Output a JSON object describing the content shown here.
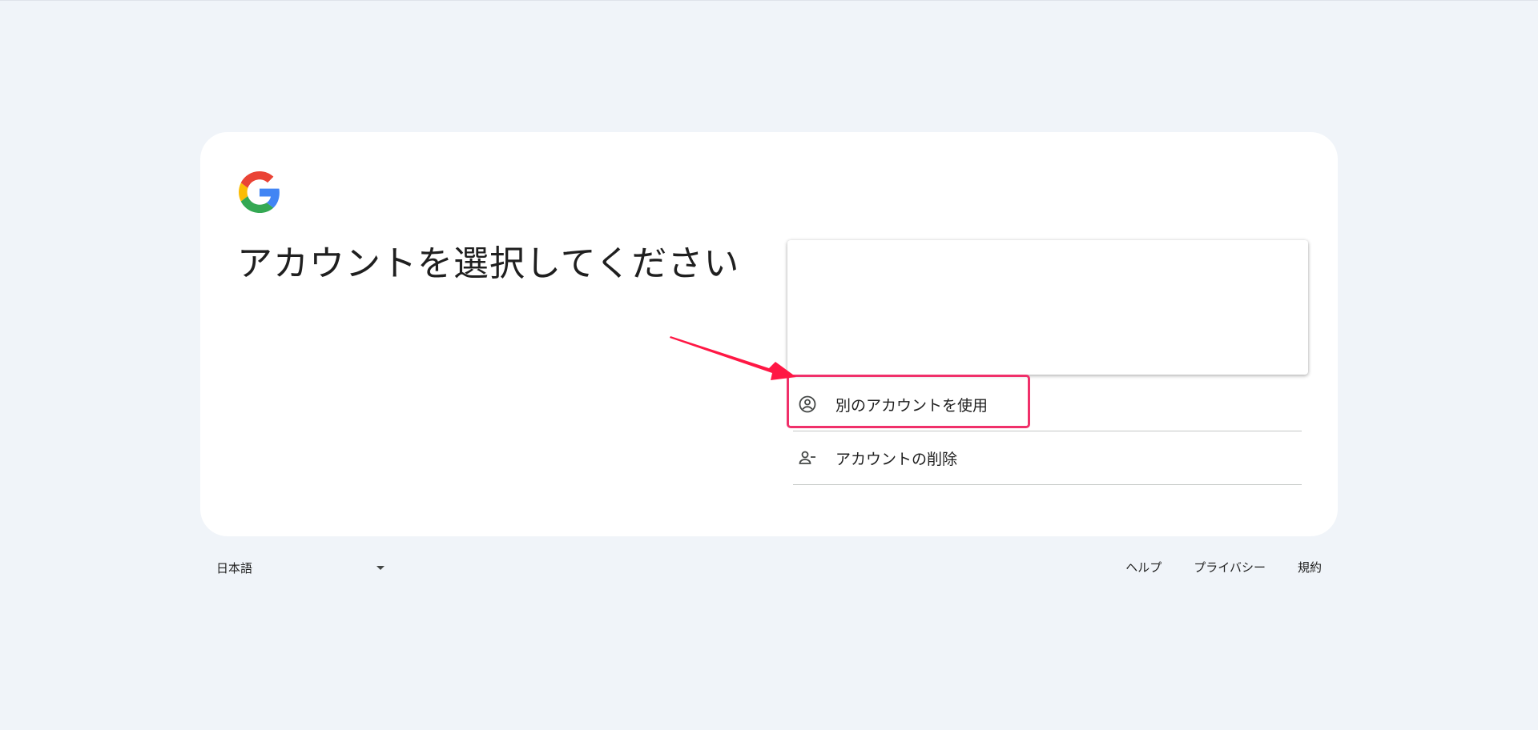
{
  "heading": "アカウントを選択してください",
  "options": {
    "use_other": {
      "label": "別のアカウントを使用",
      "icon": "account-circle-icon"
    },
    "remove": {
      "label": "アカウントの削除",
      "icon": "person-remove-icon"
    }
  },
  "footer": {
    "language": "日本語",
    "links": [
      "ヘルプ",
      "プライバシー",
      "規約"
    ]
  },
  "colors": {
    "background": "#f0f4f9",
    "card": "#ffffff",
    "annotation": "#f0306a",
    "arrow": "#ff1744"
  }
}
